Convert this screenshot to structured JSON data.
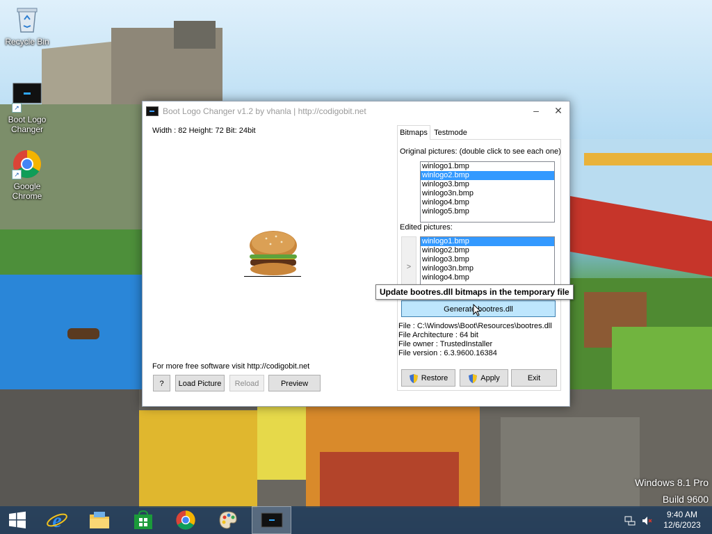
{
  "desktop": {
    "icons": [
      {
        "label": "Recycle Bin"
      },
      {
        "label": "Boot Logo Changer"
      },
      {
        "label": "Google Chrome"
      }
    ],
    "watermark": {
      "line1": "Windows 8.1 Pro",
      "line2": "Build 9600"
    }
  },
  "window": {
    "title": "Boot Logo Changer v1.2 by vhanla | http://codigobit.net",
    "minimize_symbol": "–",
    "close_symbol": "✕",
    "image_info": "Width : 82 Height: 72 Bit: 24bit",
    "footer_text": "For more free software visit  http://codigobit.net",
    "buttons": {
      "help": "?",
      "load_picture": "Load Picture",
      "reload": "Reload",
      "preview": "Preview",
      "generate": "Generate bootres.dll",
      "restore": "Restore",
      "apply": "Apply",
      "exit": "Exit",
      "move_arrow": ">"
    },
    "tabs": [
      "Bitmaps",
      "Testmode"
    ],
    "original_label": "Original pictures: (double click to see each one)",
    "original_pictures": [
      "winlogo1.bmp",
      "winlogo2.bmp",
      "winlogo3.bmp",
      "winlogo3n.bmp",
      "winlogo4.bmp",
      "winlogo5.bmp"
    ],
    "original_selected": "winlogo2.bmp",
    "edited_label": "Edited pictures:",
    "edited_pictures": [
      "winlogo1.bmp",
      "winlogo2.bmp",
      "winlogo3.bmp",
      "winlogo3n.bmp",
      "winlogo4.bmp"
    ],
    "edited_selected": "winlogo1.bmp",
    "file_info": {
      "file": "File : C:\\Windows\\Boot\\Resources\\bootres.dll",
      "arch": "File Architecture : 64 bit",
      "owner": "File owner : TrustedInstaller",
      "version": "File version : 6.3.9600.16384"
    },
    "tooltip": "Update bootres.dll bitmaps in the temporary file"
  },
  "taskbar": {
    "items": [
      "windows-start",
      "internet-explorer",
      "file-explorer",
      "windows-store",
      "google-chrome",
      "paint",
      "boot-logo-changer"
    ],
    "clock": {
      "time": "9:40 AM",
      "date": "12/6/2023"
    }
  },
  "colors": {
    "selection": "#3399ff",
    "taskbar": "#1e3c5f"
  }
}
